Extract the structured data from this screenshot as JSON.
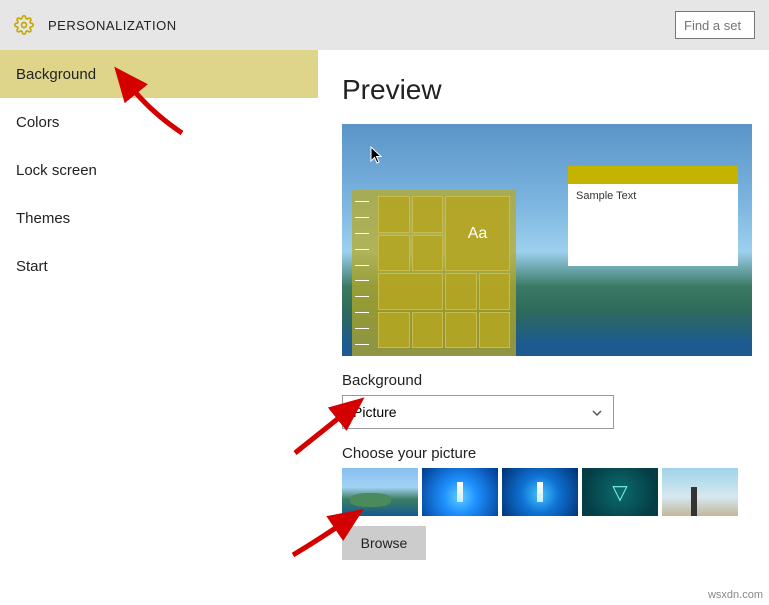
{
  "header": {
    "title": "PERSONALIZATION",
    "search_placeholder": "Find a set"
  },
  "sidebar": {
    "items": [
      {
        "label": "Background"
      },
      {
        "label": "Colors"
      },
      {
        "label": "Lock screen"
      },
      {
        "label": "Themes"
      },
      {
        "label": "Start"
      }
    ],
    "active_index": 0
  },
  "main": {
    "preview_heading": "Preview",
    "preview_window_text": "Sample Text",
    "preview_tile_aa": "Aa",
    "background_label": "Background",
    "background_dropdown_value": "Picture",
    "choose_label": "Choose your picture",
    "thumbnails": [
      {
        "name": "crater-bay"
      },
      {
        "name": "windows-hero-1"
      },
      {
        "name": "windows-hero-2"
      },
      {
        "name": "teal-triangle"
      },
      {
        "name": "beach-walker"
      }
    ],
    "browse_label": "Browse"
  },
  "watermark": "wsxdn.com"
}
